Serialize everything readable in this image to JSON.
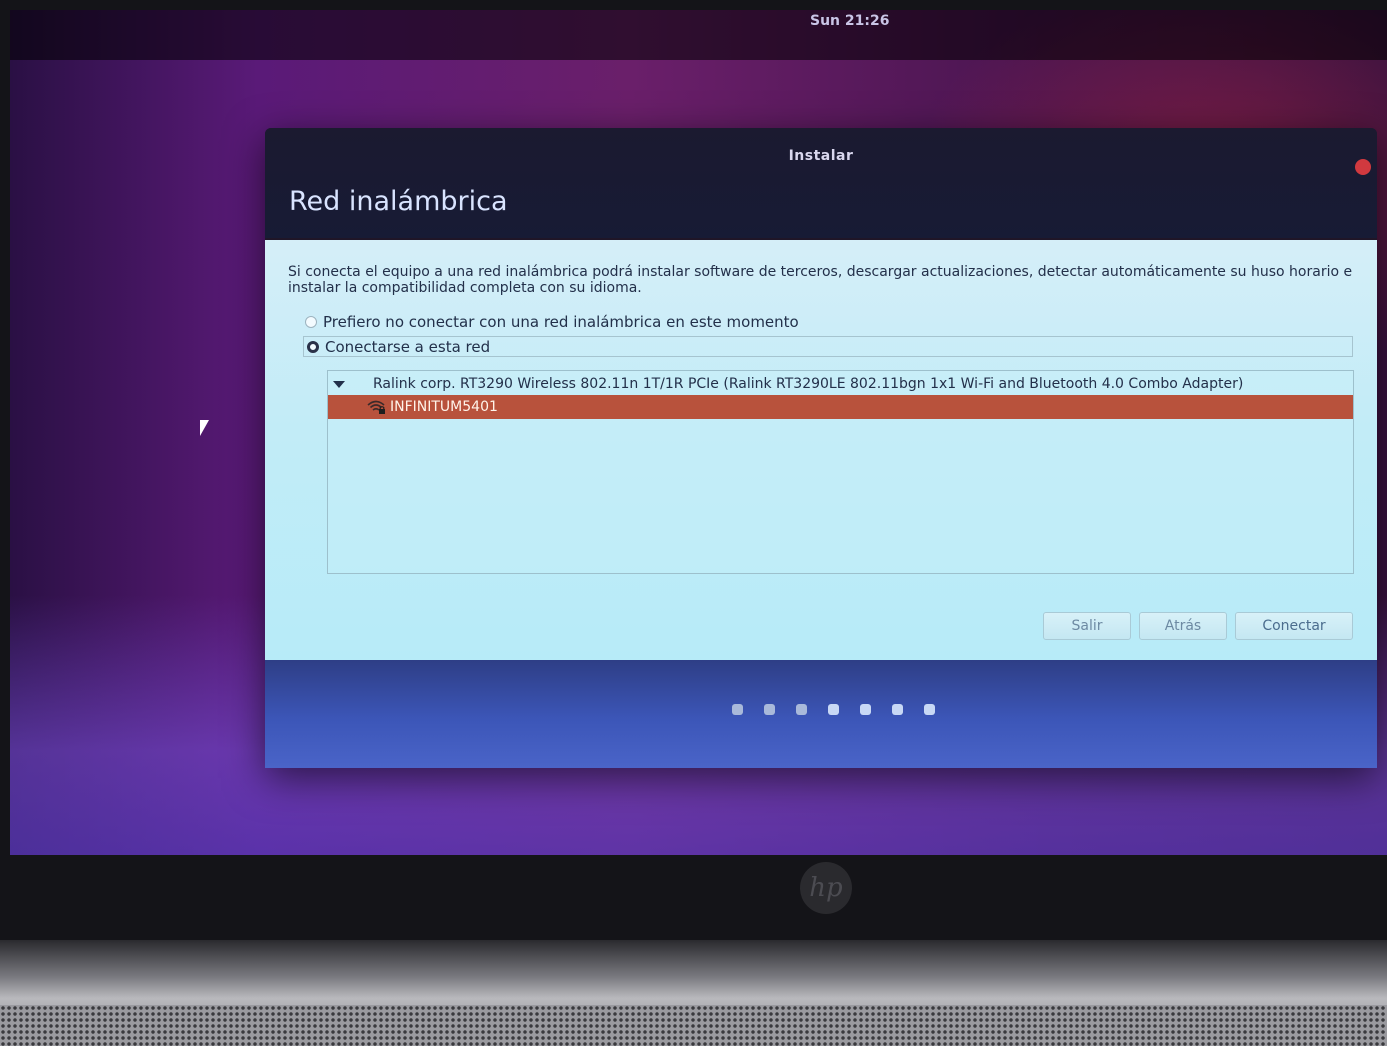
{
  "topbar": {
    "clock": "Sun 21:26"
  },
  "window": {
    "title": "Instalar",
    "page_title": "Red inalámbrica"
  },
  "content": {
    "description": "Si conecta el equipo a una red inalámbrica podrá instalar software de terceros, descargar actualizaciones, detectar automáticamente su huso horario e instalar la compatibilidad completa con su idioma.",
    "options": [
      {
        "label": "Prefiero no conectar con una red inalámbrica en este momento",
        "selected": false
      },
      {
        "label": "Conectarse a esta red",
        "selected": true
      }
    ],
    "adapter": "Ralink corp. RT3290 Wireless 802.11n 1T/1R PCIe (Ralink RT3290LE 802.11bgn 1x1 Wi-Fi and Bluetooth 4.0 Combo Adapter)",
    "networks": [
      {
        "ssid": "INFINITUM5401",
        "secured": true,
        "selected": true,
        "icon": "wifi-locked-icon"
      }
    ]
  },
  "buttons": {
    "quit": "Salir",
    "back": "Atrás",
    "connect": "Conectar"
  },
  "progress": {
    "total_steps": 7,
    "completed_steps": 3
  },
  "colors": {
    "selection": "#b8523c",
    "content_bg": "#c2ecf7",
    "footer_bg": "#3c56b8",
    "close_button": "#d1393f"
  },
  "branding": {
    "logo": "hp"
  }
}
